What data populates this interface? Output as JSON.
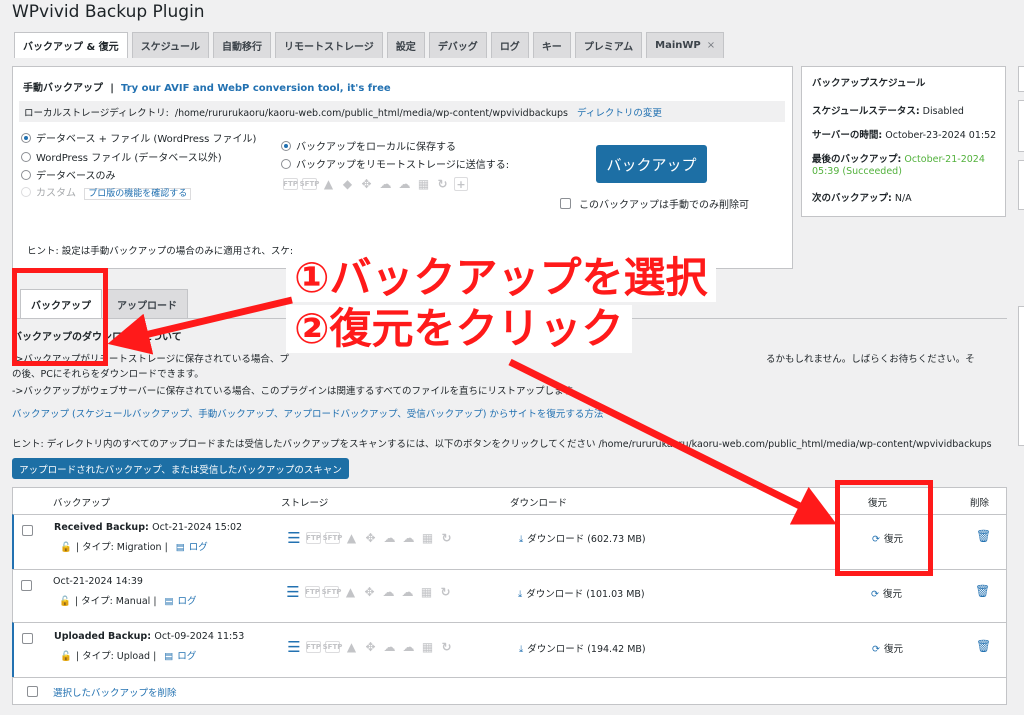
{
  "app": {
    "title": "WPvivid Backup Plugin"
  },
  "tabs": [
    {
      "label": "バックアップ & 復元",
      "active": true
    },
    {
      "label": "スケジュール"
    },
    {
      "label": "自動移行"
    },
    {
      "label": "リモートストレージ"
    },
    {
      "label": "設定"
    },
    {
      "label": "デバッグ"
    },
    {
      "label": "ログ"
    },
    {
      "label": "キー"
    },
    {
      "label": "プレミアム"
    },
    {
      "label": "MainWP",
      "close": "×"
    }
  ],
  "manual": {
    "title": "手動バックアップ",
    "sep": "|",
    "promo_link": "Try our AVIF and WebP conversion tool, it's free",
    "dir_label": "ローカルストレージディレクトリ:",
    "dir_path": "/home/rururukaoru/kaoru-web.com/public_html/media/wp-content/wpvividbackups",
    "dir_change": "ディレクトリの変更",
    "content_options": [
      {
        "label": "データベース + ファイル (WordPress ファイル)",
        "selected": true
      },
      {
        "label": "WordPress ファイル (データベース以外)"
      },
      {
        "label": "データベースのみ"
      },
      {
        "label": "カスタム",
        "disabled": true
      }
    ],
    "pro_badge": "プロ版の機能を確認する",
    "dest_options": [
      {
        "label": "バックアップをローカルに保存する",
        "selected": true
      },
      {
        "label": "バックアップをリモートストレージに送信する:"
      }
    ],
    "backup_button": "バックアップ",
    "manual_delete_label": "このバックアップは手動でのみ削除可",
    "hint": "ヒント: 設定は手動バックアップの場合のみに適用され、スケ:"
  },
  "schedule": {
    "title": "バックアップスケジュール",
    "status_label": "スケジュールステータス:",
    "status_value": "Disabled",
    "server_time_label": "サーバーの時間:",
    "server_time_value": "October-23-2024 01:52",
    "last_backup_label": "最後のバックアップ:",
    "last_backup_value1": "October-21-2024",
    "last_backup_value2": "05:39 (Succeeded)",
    "next_backup_label": "次のバックアップ:",
    "next_backup_value": "N/A",
    "status_color": "#52b13c"
  },
  "lower_tabs": [
    {
      "label": "バックアップ",
      "active": true
    },
    {
      "label": "アップロード"
    }
  ],
  "info": {
    "heading": "バックアップのダウンロードについて",
    "line1": "->バックアップがリモートストレージに保存されている場合、プ",
    "line1_end": "るかもしれません。しばらくお待ちください。そ",
    "line2": "の後、PCにそれらをダウンロードできます。",
    "line3": "->バックアップがウェブサーバーに保存されている場合、このプラグインは関連するすべてのファイルを直ちにリストアップします。",
    "restore_link": "バックアップ (スケジュールバックアップ、手動バックアップ、アップロードバックアップ、受信バックアップ) からサイトを復元する方法",
    "scan_hint": "ヒント: ディレクトリ内のすべてのアップロードまたは受信したバックアップをスキャンするには、以下のボタンをクリックしてください /home/rururukaoru/kaoru-web.com/public_html/media/wp-content/wpvividbackups",
    "scan_button": "アップロードされたバックアップ、または受信したバックアップのスキャン"
  },
  "table": {
    "headers": {
      "backup": "バックアップ",
      "storage": "ストレージ",
      "download": "ダウンロード",
      "restore": "復元",
      "delete": "削除"
    },
    "rows": [
      {
        "prefix": "Received Backup: ",
        "date": "Oct-21-2024 15:02",
        "type": "| タイプ: Migration |",
        "log": "ログ",
        "download": "ダウンロード (602.73 MB)",
        "restore": "復元"
      },
      {
        "prefix": "",
        "date": "Oct-21-2024 14:39",
        "type": "| タイプ: Manual |",
        "log": "ログ",
        "download": "ダウンロード (101.03 MB)",
        "restore": "復元"
      },
      {
        "prefix": "Uploaded Backup: ",
        "date": "Oct-09-2024 11:53",
        "type": "| タイプ: Upload |",
        "log": "ログ",
        "download": "ダウンロード (194.42 MB)",
        "restore": "復元"
      }
    ],
    "delete_selected": "選択したバックアップを削除"
  },
  "storage_icons": [
    "FTP",
    "SFTP"
  ],
  "annotations": {
    "step1": "①バックアップを選択",
    "step2": "②復元をクリック",
    "color": "#ff1a1a"
  }
}
